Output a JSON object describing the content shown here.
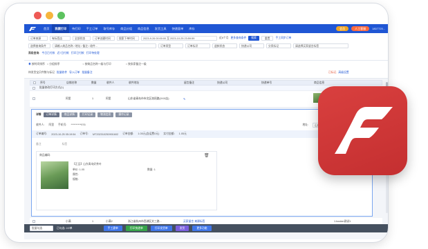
{
  "window": {
    "dot_colors": [
      "#ee5a55",
      "#f6b53d",
      "#5dc25f"
    ]
  },
  "topnav": {
    "items": [
      "首页",
      "我要打印",
      "待打印",
      "手工订单",
      "取号库存",
      "商品分组",
      "商品信息",
      "发货工具",
      "快递面单",
      "库存"
    ],
    "active_index": 1,
    "right": {
      "vip": "会员",
      "ai": "人工客服",
      "user": "1807725..."
    }
  },
  "filters": {
    "row1": [
      "订单来源",
      "有标签店",
      "全部状态",
      "订单创建时间",
      "搜索下单时间",
      "2023-9-26 00:00:00 至 2023-10-25 23:59:59"
    ],
    "row1_extra": [
      "近6个月",
      "更多查询条件"
    ],
    "search_btn": "搜索",
    "reset_btn": "重置",
    "sync_link": "手工同步订单",
    "row2": [
      "选择查询条件",
      "请输入商品名称 / 地址 / 备注 / 收件...",
      "订单类型",
      "订单标识",
      "退款状态",
      "快递公司",
      "分类标记",
      "请选择买家留言标签"
    ],
    "row3_label": "高级查询:",
    "row3_items": [
      "今日已付款",
      "近7日付款",
      "打印已付款",
      "打印待处理"
    ]
  },
  "actions": {
    "radios": [
      "按时间排序",
      "分组排序",
      "按商品名称一级与打印",
      "按卖家备注一级"
    ],
    "summary": "待发货宝贝件数与标记",
    "links": [
      "批量收件",
      "导入订单",
      "批量备注"
    ],
    "right": [
      "已标记",
      "高级设置"
    ]
  },
  "table": {
    "headers": [
      "序号",
      "店铺名称",
      "数量",
      "收件人",
      "收件地址",
      "留言备注",
      "快递公司",
      "快递单号",
      "商品信息"
    ],
    "group_link": "批量修改打印方式(1)",
    "rows": [
      {
        "name": "阿里",
        "qty": "1",
        "receiver": "阿里",
        "address": "山东省青岛市市北区洛阳路(XXX店)",
        "info": "1份(6)"
      },
      {
        "name": "小满",
        "qty": "1",
        "receiver": "小满2",
        "address": "浙江省杭州市西湖区文三路...",
        "remark": "买家留言 来源标签",
        "express": "",
        "number": "",
        "goods": "1.tocdan测试1"
      },
      {
        "name": "翔翔园",
        "qty": "1",
        "receiver": "翔翔园",
        "address": "江苏省苏州市吴中区...",
        "remark": "买家留言 来源标签",
        "express": "顺丰速运一级",
        "number": "SF1071664002179",
        "goods": "2.tocdan测试2"
      }
    ]
  },
  "panel": {
    "tabs": [
      "订单详情",
      "商品详情",
      "打印记录",
      "物流信息",
      "操作记录"
    ],
    "fields": {
      "receiver_label": "收件人:",
      "receiver": "阿里",
      "phone_label": "手机号:",
      "phone": "**********976",
      "order_label": "订单编号:",
      "order_no": "2023-10-25 05:19:54",
      "order_sn_label": "订单号:",
      "order_sn": "MT202310250901602",
      "amount_label": "订单金额:",
      "amount": "1.05元(含运费0元)",
      "paid_label": "实付金额:",
      "paid": "1.05元",
      "region_label": "地址:",
      "region": "山东省青岛市市北区",
      "note_label": "备注",
      "tag_label": "标签",
      "flag_label": "旗帜"
    },
    "product": {
      "section": "商品编码:",
      "title": "【正品】山东青岛好茶叶",
      "price_label": "单价:",
      "price": "1.05",
      "attr_label": "属性:",
      "qty_label": "数量:",
      "qty": "1",
      "spec_label": "规格:"
    }
  },
  "bottom": {
    "select": "批量勾选",
    "count": "已勾选: 2/2单",
    "buttons": [
      "手工建单",
      "打印快递单",
      "打印发货单",
      "发货",
      "更多功能"
    ],
    "button_colors": [
      "#3f76ea",
      "#37a54a",
      "#3f76ea",
      "#7a5fe0",
      "#3f76ea"
    ]
  },
  "colors": {
    "brand": "#1f56d4",
    "logo_red": "#d23a3a"
  }
}
